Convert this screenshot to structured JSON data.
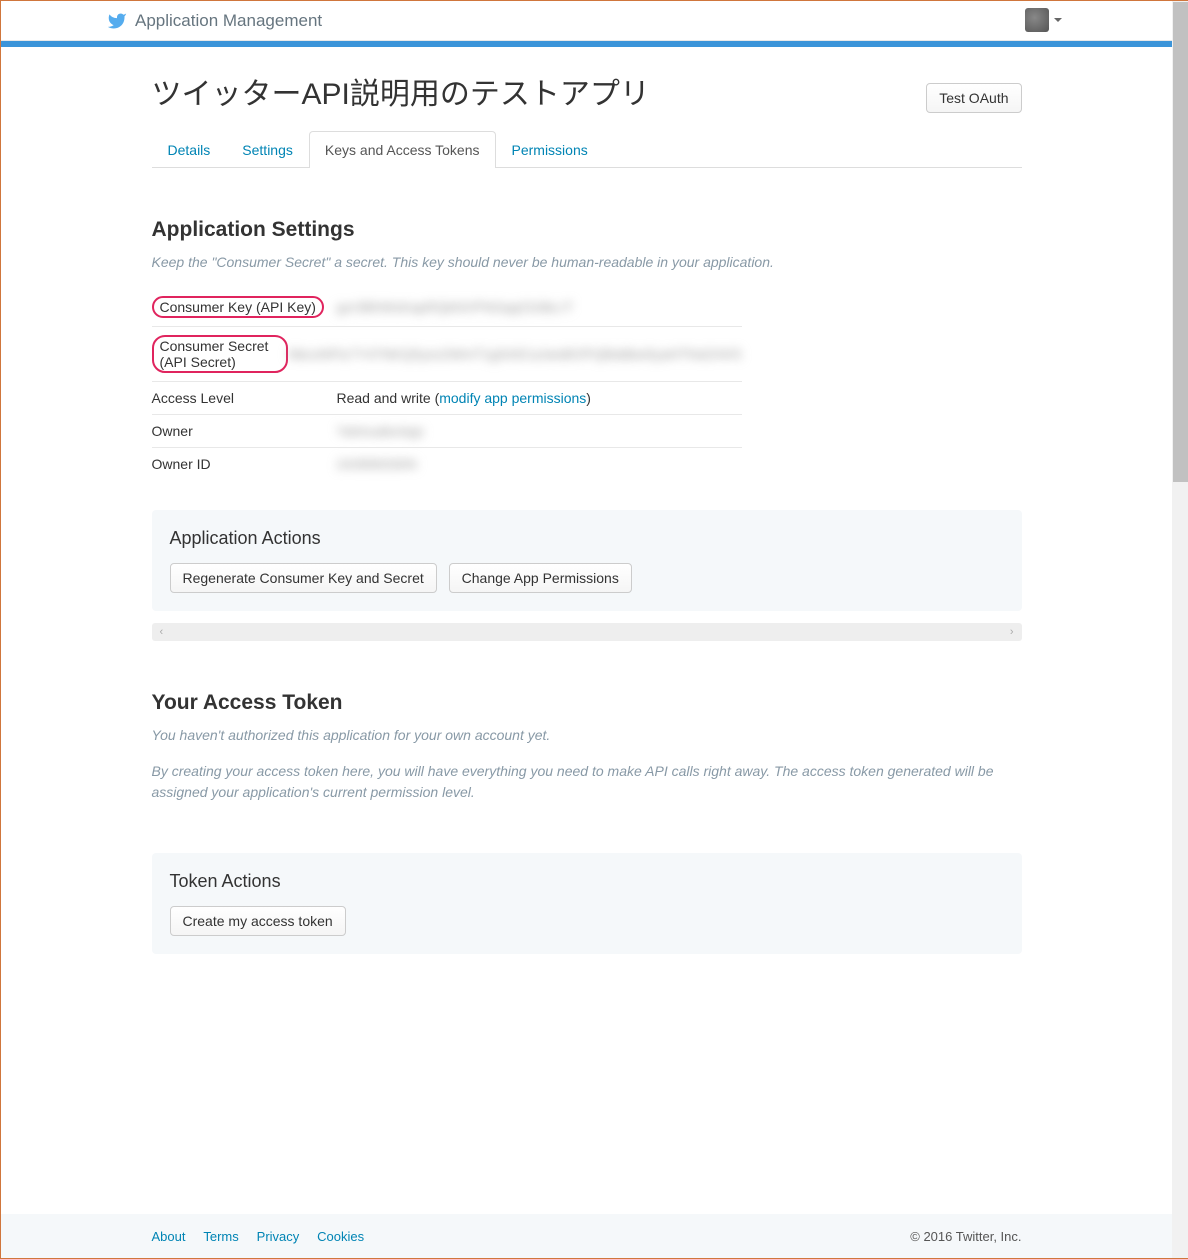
{
  "nav": {
    "title": "Application Management"
  },
  "header": {
    "title": "ツイッターAPI説明用のテストアプリ",
    "test_oauth_label": "Test OAuth"
  },
  "tabs": [
    {
      "label": "Details"
    },
    {
      "label": "Settings"
    },
    {
      "label": "Keys and Access Tokens"
    },
    {
      "label": "Permissions"
    }
  ],
  "app_settings": {
    "heading": "Application Settings",
    "desc": "Keep the \"Consumer Secret\" a secret. This key should never be human-readable in your application.",
    "rows": {
      "consumer_key_label": "Consumer Key (API Key)",
      "consumer_key_value": "gxr3BhWsKapRQkNVPNGqqCk3bLrT",
      "consumer_secret_label": "Consumer Secret (API Secret)",
      "consumer_secret_value": "NbcsNFtz7Y47NKQ5ysx2WmT1g543CaJwsBOPQBddbw5yaHTNsDXK5",
      "access_level_label": "Access Level",
      "access_level_value": "Read and write ",
      "access_level_link": "modify app permissions",
      "owner_label": "Owner",
      "owner_value": "YatmuabsApp",
      "owner_id_label": "Owner ID",
      "owner_id_value": "243999330N"
    }
  },
  "app_actions": {
    "heading": "Application Actions",
    "regenerate_label": "Regenerate Consumer Key and Secret",
    "change_perms_label": "Change App Permissions"
  },
  "access_token": {
    "heading": "Your Access Token",
    "desc1": "You haven't authorized this application for your own account yet.",
    "desc2": "By creating your access token here, you will have everything you need to make API calls right away. The access token generated will be assigned your application's current permission level."
  },
  "token_actions": {
    "heading": "Token Actions",
    "create_label": "Create my access token"
  },
  "footer": {
    "links": [
      "About",
      "Terms",
      "Privacy",
      "Cookies"
    ],
    "copy": "© 2016 Twitter, Inc."
  }
}
